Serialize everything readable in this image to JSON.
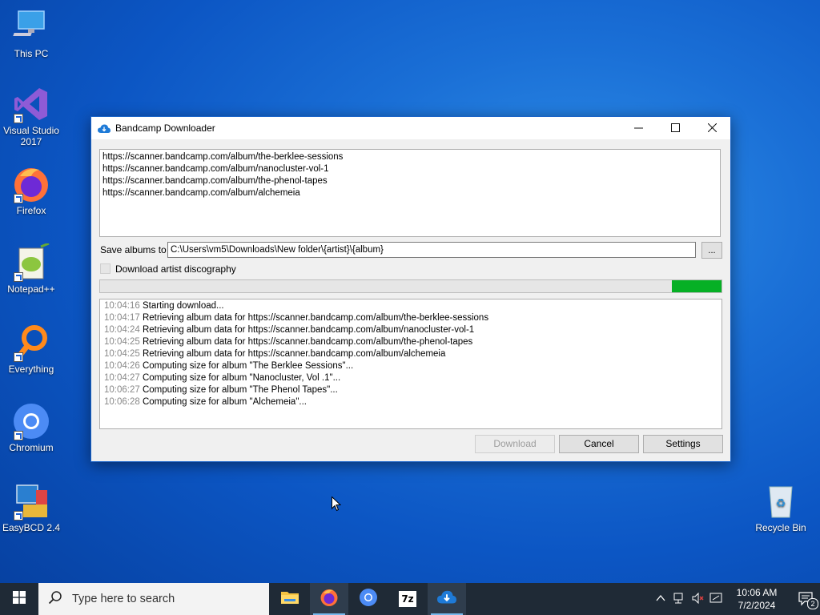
{
  "desktop": {
    "icons": [
      {
        "label": "This PC"
      },
      {
        "label": "Visual Studio 2017"
      },
      {
        "label": "Firefox"
      },
      {
        "label": "Notepad++"
      },
      {
        "label": "Everything"
      },
      {
        "label": "Chromium"
      },
      {
        "label": "EasyBCD 2.4"
      },
      {
        "label": "Recycle Bin"
      }
    ]
  },
  "window": {
    "title": "Bandcamp Downloader",
    "minimize_icon": "minimize-icon",
    "maximize_icon": "maximize-icon",
    "close_icon": "close-icon",
    "urls": [
      "https://scanner.bandcamp.com/album/the-berklee-sessions",
      "https://scanner.bandcamp.com/album/nanocluster-vol-1",
      "https://scanner.bandcamp.com/album/the-phenol-tapes",
      "https://scanner.bandcamp.com/album/alchemeia"
    ],
    "save_label": "Save albums to",
    "save_path": "C:\\Users\\vm5\\Downloads\\New folder\\{artist}\\{album}",
    "browse_label": "...",
    "discography_label": "Download artist discography",
    "discography_checked": false,
    "progress_fraction": 0.08,
    "progress_color": "#06b025",
    "log": [
      {
        "time": "10:04:16",
        "msg": "Starting download..."
      },
      {
        "time": "10:04:17",
        "msg": "Retrieving album data for https://scanner.bandcamp.com/album/the-berklee-sessions"
      },
      {
        "time": "10:04:24",
        "msg": "Retrieving album data for https://scanner.bandcamp.com/album/nanocluster-vol-1"
      },
      {
        "time": "10:04:25",
        "msg": "Retrieving album data for https://scanner.bandcamp.com/album/the-phenol-tapes"
      },
      {
        "time": "10:04:25",
        "msg": "Retrieving album data for https://scanner.bandcamp.com/album/alchemeia"
      },
      {
        "time": "10:04:26",
        "msg": "Computing size for album \"The Berklee Sessions\"..."
      },
      {
        "time": "10:04:27",
        "msg": "Computing size for album \"Nanocluster, Vol .1\"..."
      },
      {
        "time": "10:06:27",
        "msg": "Computing size for album \"The Phenol Tapes\"..."
      },
      {
        "time": "10:06:28",
        "msg": "Computing size for album \"Alchemeia\"..."
      }
    ],
    "buttons": {
      "download": "Download",
      "cancel": "Cancel",
      "settings": "Settings"
    }
  },
  "taskbar": {
    "search_placeholder": "Type here to search",
    "apps": [
      "file-explorer-icon",
      "firefox-icon",
      "chromium-icon",
      "7zip-icon",
      "bandcamp-downloader-icon"
    ],
    "app_7z_label": "7z",
    "clock_time": "10:06 AM",
    "clock_date": "7/2/2024",
    "notification_count": "2"
  }
}
